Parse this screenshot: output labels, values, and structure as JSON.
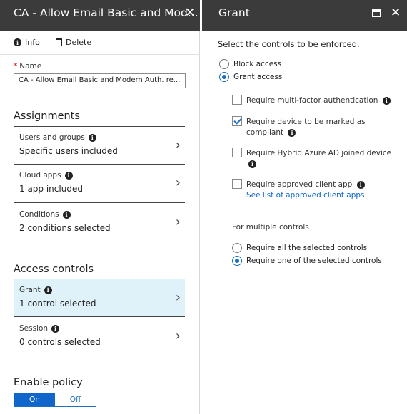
{
  "left_blade": {
    "title": "CA - Allow Email Basic and Mod...",
    "close": "✕",
    "commands": {
      "info": "Info",
      "delete": "Delete"
    },
    "name_field": {
      "required_marker": "*",
      "label": "Name",
      "value": "CA - Allow Email Basic and Modern Auth. re..."
    },
    "assignments_title": "Assignments",
    "assignments": [
      {
        "label": "Users and groups",
        "value": "Specific users included"
      },
      {
        "label": "Cloud apps",
        "value": "1 app included"
      },
      {
        "label": "Conditions",
        "value": "2 conditions selected"
      }
    ],
    "access_title": "Access controls",
    "access": [
      {
        "label": "Grant",
        "value": "1 control selected",
        "selected": true
      },
      {
        "label": "Session",
        "value": "0 controls selected",
        "selected": false
      }
    ],
    "enable_title": "Enable policy",
    "toggle": {
      "on": "On",
      "off": "Off",
      "state": "On"
    },
    "chevron": "›",
    "info_glyph": "i"
  },
  "right_blade": {
    "title": "Grant",
    "close": "✕",
    "instruction": "Select the controls to be enforced.",
    "access_options": [
      {
        "label": "Block access",
        "checked": false
      },
      {
        "label": "Grant access",
        "checked": true
      }
    ],
    "controls": [
      {
        "line1": "Require multi-factor authentication",
        "checked": false
      },
      {
        "line1": "Require device to be marked as",
        "line2": "compliant",
        "checked": true
      },
      {
        "line1": "Require Hybrid Azure AD joined device",
        "checked": false
      },
      {
        "line1": "Require approved client app",
        "link": "See list of approved client apps",
        "checked": false
      }
    ],
    "multi_label": "For multiple controls",
    "multi_options": [
      {
        "label": "Require all the selected controls",
        "checked": false
      },
      {
        "label": "Require one of the selected controls",
        "checked": true
      }
    ]
  },
  "colors": {
    "header_bg": "#3b3b3b",
    "accent": "#1166cc",
    "selected_bg": "#dff1f9"
  }
}
